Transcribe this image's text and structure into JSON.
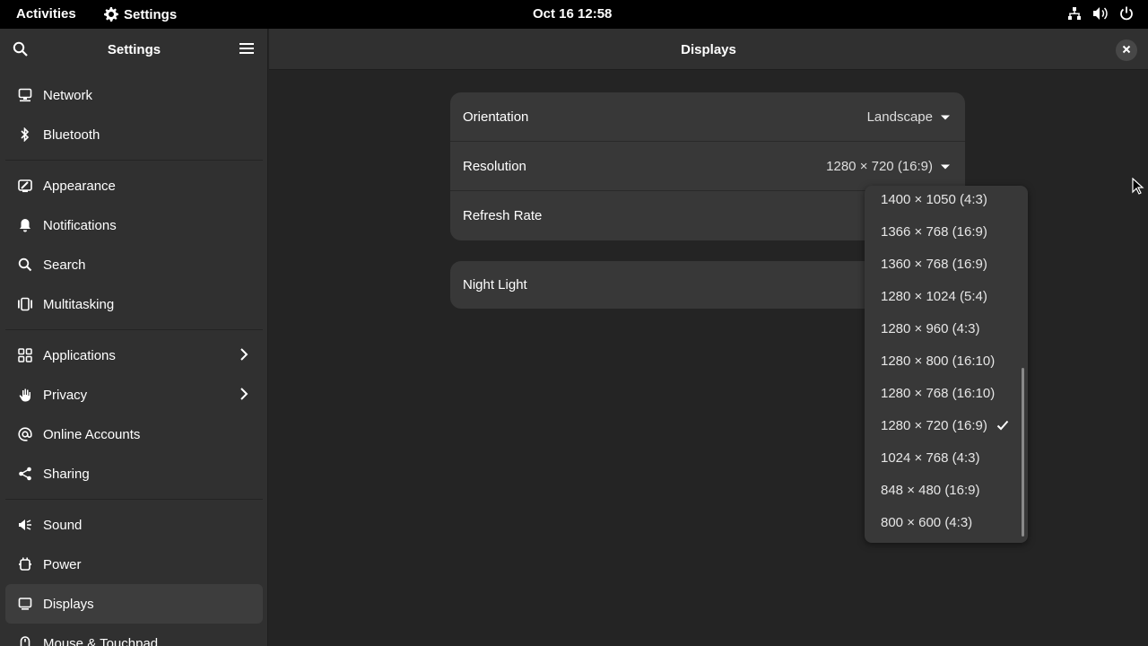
{
  "topbar": {
    "activities": "Activities",
    "app_name": "Settings",
    "clock": "Oct 16  12:58",
    "tray_icons": [
      "network-wired-icon",
      "volume-icon",
      "power-icon"
    ]
  },
  "sidebar": {
    "title": "Settings",
    "items": [
      {
        "label": "Network",
        "icon": "network-icon"
      },
      {
        "label": "Bluetooth",
        "icon": "bluetooth-icon"
      },
      {
        "label": "Appearance",
        "icon": "appearance-icon"
      },
      {
        "label": "Notifications",
        "icon": "bell-icon"
      },
      {
        "label": "Search",
        "icon": "search-icon"
      },
      {
        "label": "Multitasking",
        "icon": "multitasking-icon"
      },
      {
        "label": "Applications",
        "icon": "apps-grid-icon"
      },
      {
        "label": "Privacy",
        "icon": "hand-icon"
      },
      {
        "label": "Online Accounts",
        "icon": "at-icon"
      },
      {
        "label": "Sharing",
        "icon": "share-icon"
      },
      {
        "label": "Sound",
        "icon": "speaker-icon"
      },
      {
        "label": "Power",
        "icon": "power-plug-icon"
      },
      {
        "label": "Displays",
        "icon": "display-icon"
      },
      {
        "label": "Mouse & Touchpad",
        "icon": "mouse-icon"
      }
    ]
  },
  "main": {
    "title": "Displays",
    "rows": {
      "orientation": {
        "label": "Orientation",
        "value": "Landscape"
      },
      "resolution": {
        "label": "Resolution",
        "value": "1280 × 720 (16:9)"
      },
      "refresh_rate": {
        "label": "Refresh Rate"
      },
      "night_light": {
        "label": "Night Light"
      }
    }
  },
  "resolution_popover": {
    "selected": "1280 × 720 (16:9)",
    "options": [
      "1400 × 1050 (4:3)",
      "1366 × 768 (16:9)",
      "1360 × 768 (16:9)",
      "1280 × 1024 (5:4)",
      "1280 × 960 (4:3)",
      "1280 × 800 (16:10)",
      "1280 × 768 (16:10)",
      "1280 × 720 (16:9)",
      "1024 × 768 (4:3)",
      "848 × 480 (16:9)",
      "800 × 600 (4:3)"
    ]
  },
  "colors": {
    "topbar_bg": "#000000",
    "sidebar_bg": "#303030",
    "content_bg": "#242424",
    "card_bg": "#383838",
    "active_item_bg": "#3d3d3d"
  }
}
